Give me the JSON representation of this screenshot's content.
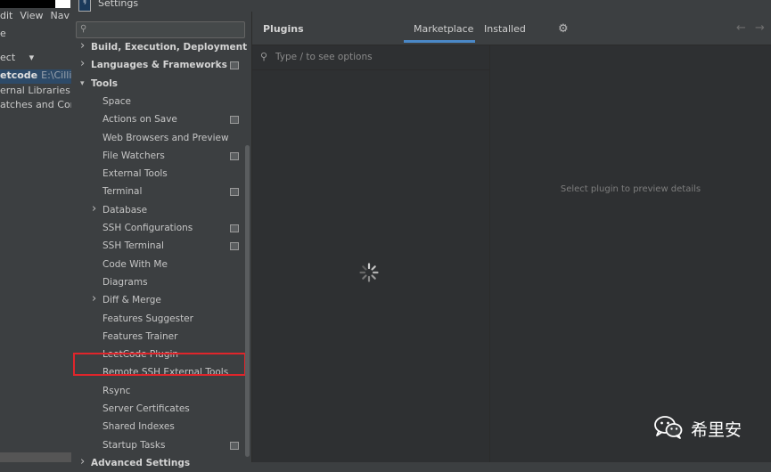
{
  "ide_background": {
    "menu": [
      "dit",
      "View",
      "Nav"
    ],
    "toolbar_text": "e",
    "project_selector": "ect",
    "project_selector_arrow": "▾",
    "tree": {
      "project_name": "etcode",
      "project_path": "E:\\Cillian",
      "libraries": "ernal Libraries",
      "scratches": "atches and Cons"
    }
  },
  "dialog": {
    "title": "Settings",
    "app_icon_label": "IJ"
  },
  "sidebar": {
    "search_placeholder": "",
    "items": [
      {
        "label": "Build, Execution, Deployment",
        "expanded": false,
        "bold": true
      },
      {
        "label": "Languages & Frameworks",
        "expanded": false,
        "bold": true,
        "project_icon": true
      },
      {
        "label": "Tools",
        "expanded": true,
        "bold": true
      },
      {
        "label": "Space"
      },
      {
        "label": "Actions on Save",
        "project_icon": true
      },
      {
        "label": "Web Browsers and Preview"
      },
      {
        "label": "File Watchers",
        "project_icon": true
      },
      {
        "label": "External Tools"
      },
      {
        "label": "Terminal",
        "project_icon": true
      },
      {
        "label": "Database",
        "expandable": true
      },
      {
        "label": "SSH Configurations",
        "project_icon": true
      },
      {
        "label": "SSH Terminal",
        "project_icon": true
      },
      {
        "label": "Code With Me"
      },
      {
        "label": "Diagrams"
      },
      {
        "label": "Diff & Merge",
        "expandable": true
      },
      {
        "label": "Features Suggester"
      },
      {
        "label": "Features Trainer"
      },
      {
        "label": "LeetCode Plugin",
        "highlighted": true
      },
      {
        "label": "Remote SSH External Tools"
      },
      {
        "label": "Rsync"
      },
      {
        "label": "Server Certificates"
      },
      {
        "label": "Shared Indexes"
      },
      {
        "label": "Startup Tasks",
        "project_icon": true
      },
      {
        "label": "Advanced Settings",
        "bold": true
      }
    ]
  },
  "plugins": {
    "title": "Plugins",
    "tabs": [
      {
        "label": "Marketplace",
        "active": true
      },
      {
        "label": "Installed",
        "active": false
      }
    ],
    "search_placeholder": "Type / to see options",
    "detail_placeholder": "Select plugin to preview details",
    "loading": true
  },
  "watermark": {
    "text": "希里安"
  },
  "colors": {
    "background": "#3c3f41",
    "panel": "#2e3032",
    "accent": "#4a88c7",
    "highlight_border": "#e0252b"
  }
}
